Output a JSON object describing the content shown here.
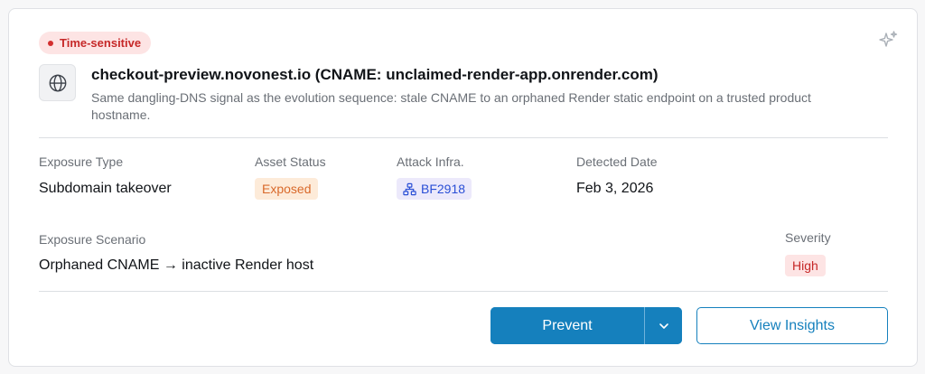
{
  "badge": {
    "label": "Time-sensitive",
    "color": "#c62828"
  },
  "asset": {
    "icon": "globe-icon",
    "title": "checkout-preview.novonest.io (CNAME: unclaimed-render-app.onrender.com)",
    "description": "Same dangling-DNS signal as the evolution sequence: stale CNAME to an orphaned Render static endpoint on a trusted product hostname."
  },
  "fields": {
    "exposure_type": {
      "label": "Exposure Type",
      "value": "Subdomain takeover"
    },
    "asset_status": {
      "label": "Asset Status",
      "value": "Exposed",
      "color": "#d9692a"
    },
    "attack_infra": {
      "label": "Attack Infra.",
      "value": "BF2918",
      "icon": "network-icon",
      "color": "#2a4fd6"
    },
    "detected_date": {
      "label": "Detected Date",
      "value": "Feb 3, 2026"
    },
    "exposure_scenario": {
      "label": "Exposure Scenario",
      "value": "Orphaned CNAME → inactive Render host"
    },
    "severity": {
      "label": "Severity",
      "value": "High",
      "color": "#c62828"
    }
  },
  "actions": {
    "prevent_label": "Prevent",
    "insights_label": "View Insights",
    "accent": "#1580bd"
  },
  "icons": {
    "top_right": "sparkle-icon",
    "split_button": "chevron-down-icon"
  }
}
